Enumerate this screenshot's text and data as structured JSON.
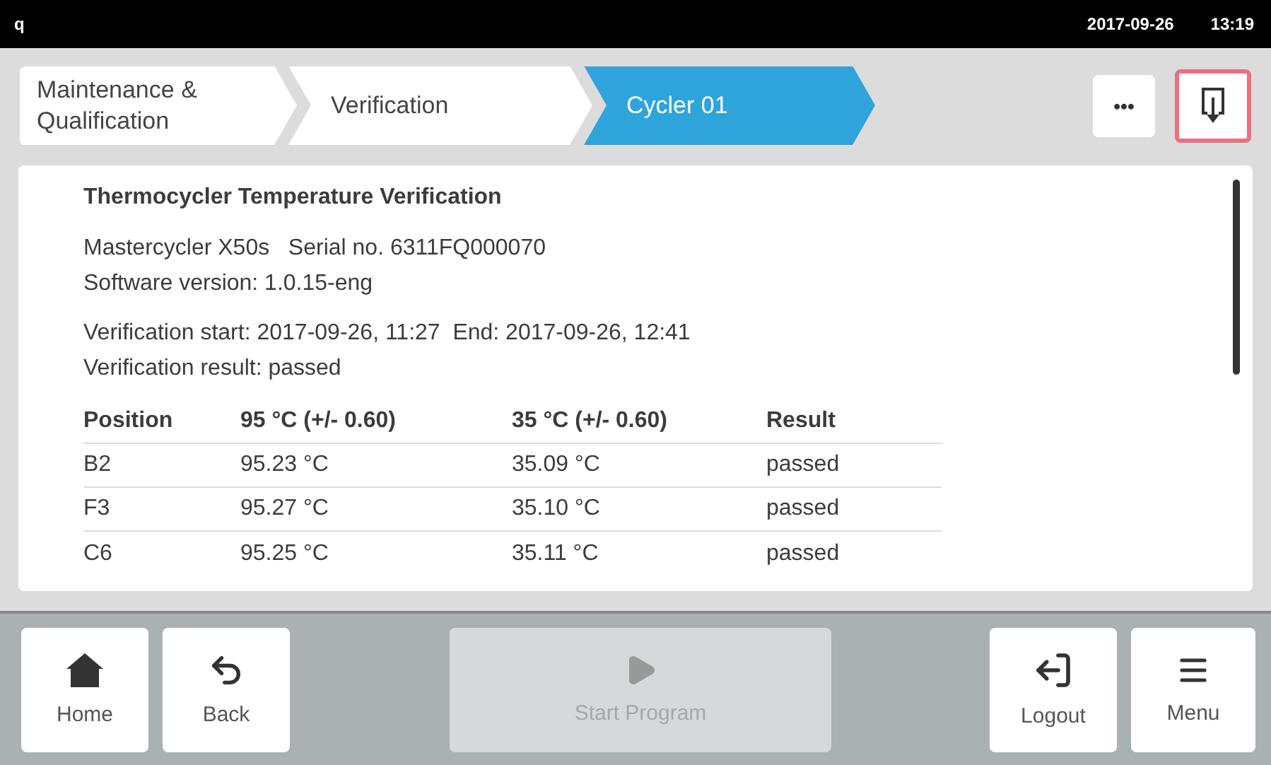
{
  "status_bar": {
    "app_letter": "q",
    "date": "2017-09-26",
    "time": "13:19"
  },
  "breadcrumbs": [
    {
      "label": "Maintenance &\nQualification",
      "selected": false
    },
    {
      "label": "Verification",
      "selected": false
    },
    {
      "label": "Cycler  01",
      "selected": true
    }
  ],
  "toolbar": {
    "more": "•••",
    "export_highlighted": true
  },
  "report": {
    "title": "Thermocycler Temperature Verification",
    "device_lines": [
      "Mastercycler X50s   Serial no. 6311FQ000070",
      "Software version: 1.0.15-eng"
    ],
    "run_lines": [
      "Verification start: 2017-09-26, 11:27  End: 2017-09-26, 12:41",
      "Verification result: passed"
    ],
    "table": {
      "columns": [
        "Position",
        "95 °C (+/- 0.60)",
        "35 °C (+/- 0.60)",
        "Result"
      ],
      "rows": [
        [
          "B2",
          "95.23 °C",
          "35.09 °C",
          "passed"
        ],
        [
          "F3",
          "95.27 °C",
          "35.10 °C",
          "passed"
        ],
        [
          "C6",
          "95.25 °C",
          "35.11 °C",
          "passed"
        ]
      ]
    }
  },
  "bottom_bar": [
    {
      "kind": "home",
      "label": "Home",
      "disabled": false
    },
    {
      "kind": "back",
      "label": "Back",
      "disabled": false
    },
    {
      "kind": "start",
      "label": "Start Program",
      "disabled": true
    },
    {
      "kind": "logout",
      "label": "Logout",
      "disabled": false
    },
    {
      "kind": "menu",
      "label": "Menu",
      "disabled": false
    }
  ]
}
